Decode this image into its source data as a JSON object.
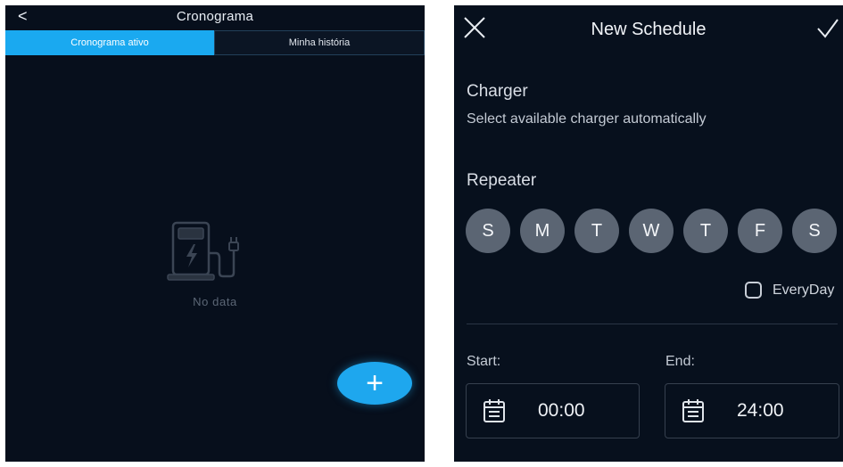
{
  "left": {
    "back_icon": "chevron-left-icon",
    "back_glyph": "<",
    "title": "Cronograma",
    "tabs": [
      {
        "label": "Cronograma ativo",
        "active": true
      },
      {
        "label": "Minha história",
        "active": false
      }
    ],
    "empty_text": "No data",
    "fab_glyph": "+",
    "accent": "#1aa9f0"
  },
  "right": {
    "close_icon": "close-icon",
    "title": "New Schedule",
    "confirm_icon": "check-icon",
    "charger_label": "Charger",
    "charger_value": "Select available charger automatically",
    "repeater_label": "Repeater",
    "days": [
      "S",
      "M",
      "T",
      "W",
      "T",
      "F",
      "S"
    ],
    "everyday_label": "EveryDay",
    "everyday_checked": false,
    "start_label": "Start:",
    "start_value": "00:00",
    "end_label": "End:",
    "end_value": "24:00"
  }
}
